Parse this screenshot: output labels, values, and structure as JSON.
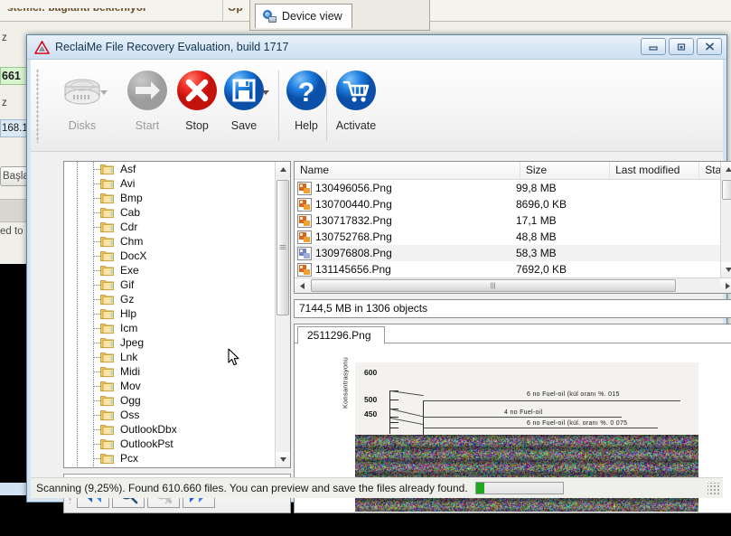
{
  "background": {
    "status_text_left": "stemci: bağlantı bekleniyor",
    "status_text_right": "Op",
    "tab_label": "Device view",
    "tab_icon": "device-magnifier-icon",
    "side_label_1": "z",
    "side_value_green": "661",
    "side_label_2": "z",
    "side_value_blue": "168.1",
    "side_button": "Başlat",
    "side_status": "ed to n"
  },
  "window": {
    "title": "ReclaiMe File Recovery Evaluation, build 1717",
    "icon": "warning-triangle-icon",
    "minimize_icon": "minimize-icon",
    "maximize_icon": "maximize-icon",
    "close_icon": "close-icon"
  },
  "toolbar": {
    "buttons": [
      {
        "label": "Disks",
        "icon": "hard-disk-icon",
        "enabled": false,
        "dropdown": true
      },
      {
        "label": "Start",
        "icon": "arrow-right-icon",
        "enabled": false,
        "dropdown": false
      },
      {
        "label": "Stop",
        "icon": "stop-x-icon",
        "enabled": true,
        "dropdown": false
      },
      {
        "label": "Save",
        "icon": "save-disk-icon",
        "enabled": true,
        "dropdown": true
      },
      {
        "label": "Help",
        "icon": "question-mark-icon",
        "enabled": true,
        "dropdown": false
      },
      {
        "label": "Activate",
        "icon": "shopping-cart-icon",
        "enabled": true,
        "dropdown": false
      }
    ]
  },
  "tree": {
    "items": [
      {
        "label": "Asf",
        "icon": "folder-icon"
      },
      {
        "label": "Avi",
        "icon": "folder-icon"
      },
      {
        "label": "Bmp",
        "icon": "folder-icon"
      },
      {
        "label": "Cab",
        "icon": "folder-icon"
      },
      {
        "label": "Cdr",
        "icon": "folder-icon"
      },
      {
        "label": "Chm",
        "icon": "folder-icon"
      },
      {
        "label": "DocX",
        "icon": "folder-icon"
      },
      {
        "label": "Exe",
        "icon": "folder-icon"
      },
      {
        "label": "Gif",
        "icon": "folder-icon"
      },
      {
        "label": "Gz",
        "icon": "folder-icon"
      },
      {
        "label": "Hlp",
        "icon": "folder-icon"
      },
      {
        "label": "Icm",
        "icon": "folder-icon"
      },
      {
        "label": "Jpeg",
        "icon": "folder-icon"
      },
      {
        "label": "Lnk",
        "icon": "folder-icon"
      },
      {
        "label": "Midi",
        "icon": "folder-icon"
      },
      {
        "label": "Mov",
        "icon": "folder-icon"
      },
      {
        "label": "Ogg",
        "icon": "folder-icon"
      },
      {
        "label": "Oss",
        "icon": "folder-icon"
      },
      {
        "label": "OutlookDbx",
        "icon": "folder-icon"
      },
      {
        "label": "OutlookPst",
        "icon": "folder-icon"
      },
      {
        "label": "Pcx",
        "icon": "folder-icon"
      }
    ]
  },
  "nav_buttons": [
    {
      "name": "back-button",
      "icon": "double-arrow-left-icon",
      "enabled": true
    },
    {
      "name": "search-button",
      "icon": "magnifier-icon",
      "enabled": true
    },
    {
      "name": "clear-search-button",
      "icon": "magnifier-cancel-icon",
      "enabled": false
    },
    {
      "name": "forward-button",
      "icon": "double-arrow-right-icon",
      "enabled": true
    }
  ],
  "file_list": {
    "columns": [
      "Name",
      "Size",
      "Last modified",
      "Statu"
    ],
    "rows": [
      {
        "name": "130496056.Png",
        "size": "99,8 MB",
        "modified": "",
        "status": "",
        "selected": false
      },
      {
        "name": "130700440.Png",
        "size": "8696,0 KB",
        "modified": "",
        "status": "",
        "selected": false
      },
      {
        "name": "130717832.Png",
        "size": "17,1 MB",
        "modified": "",
        "status": "",
        "selected": false
      },
      {
        "name": "130752768.Png",
        "size": "48,8 MB",
        "modified": "",
        "status": "",
        "selected": false
      },
      {
        "name": "130976808.Png",
        "size": "58,3 MB",
        "modified": "",
        "status": "",
        "selected": true
      },
      {
        "name": "131145656.Png",
        "size": "7692,0 KB",
        "modified": "",
        "status": "",
        "selected": false
      }
    ],
    "summary": "7144,5 MB in 1306 objects"
  },
  "preview": {
    "tab_label": "2511296.Png"
  },
  "chart_data": {
    "type": "line",
    "title": "",
    "ylabel": "Konsantrasyonu",
    "xlabel": "",
    "ytick_labels": [
      "600",
      "500",
      "450"
    ],
    "annotations": [
      "6 no  Fuel-oil  (kül  oranı %. 015",
      "4      no  Fuel-oil",
      "6 no  Fuel-oil  (kül. oranı %. 0 075"
    ],
    "note": "corrupted-scanned-chart-lower-half-noise"
  },
  "status": {
    "text": "Scanning (9,25%). Found 610.660 files. You can preview and save the files already found.",
    "progress_percent": 9.25,
    "progress_color": "#1eaa1e"
  }
}
